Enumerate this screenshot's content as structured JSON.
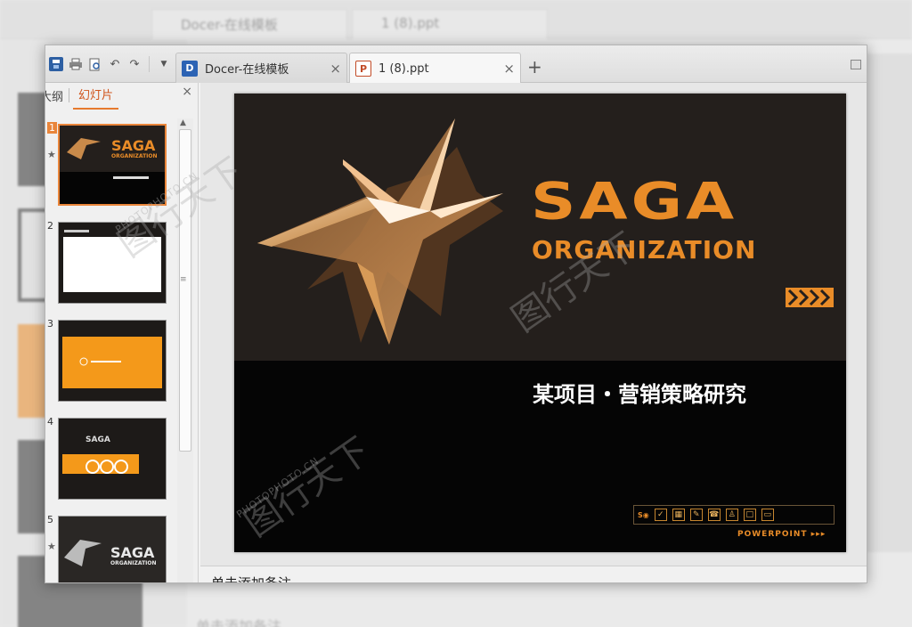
{
  "app": {
    "tabs": [
      {
        "label": "Docer-在线模板",
        "icon": "docer-icon",
        "active": false
      },
      {
        "label": "1 (8).ppt",
        "icon": "ppt-file-icon",
        "active": true
      }
    ],
    "new_tab_label": "+",
    "close_label": "×",
    "quick_access": [
      "save-icon",
      "print-icon",
      "print-preview-icon",
      "undo-icon",
      "redo-icon",
      "customize-dropdown-icon"
    ]
  },
  "sidebar": {
    "tabs": [
      {
        "label": "大纲",
        "active": false
      },
      {
        "label": "幻灯片",
        "active": true
      }
    ],
    "close_label": "×",
    "thumbnails": [
      {
        "number": "1",
        "selected": true
      },
      {
        "number": "2",
        "selected": false
      },
      {
        "number": "3",
        "selected": false
      },
      {
        "number": "4",
        "selected": false
      },
      {
        "number": "5",
        "selected": false
      }
    ]
  },
  "slide": {
    "brand_title": "SAGA",
    "brand_subtitle": "ORGANIZATION",
    "heading": "某项目・营销策略研究",
    "footer_label": "POWERPOINT ▸▸▸",
    "accent_color": "#e98c28",
    "background_color": "#231f1c"
  },
  "notes": {
    "placeholder": "单击添加备注"
  },
  "watermark": {
    "text": "PHOTOPHOTO.CN",
    "brand": "图行天下"
  }
}
